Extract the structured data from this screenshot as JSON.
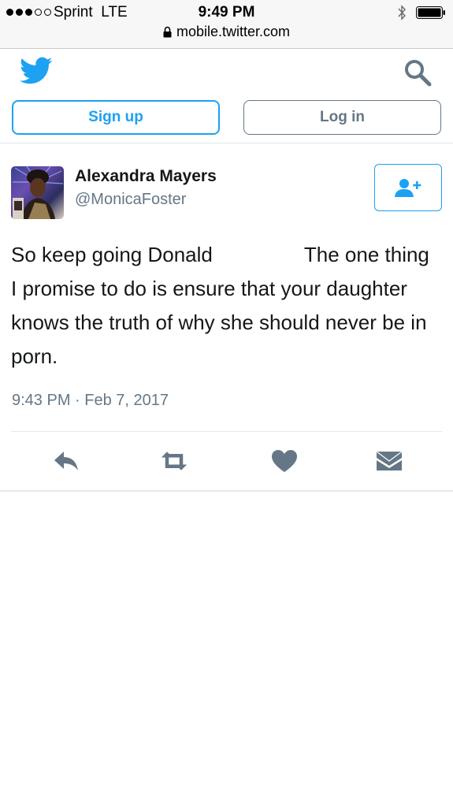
{
  "status_bar": {
    "carrier": "Sprint",
    "network": "LTE",
    "time": "9:49 PM",
    "signal_bars_filled": 3,
    "signal_bars_total": 5,
    "icons": [
      "signal-dots-icon",
      "bluetooth-icon",
      "battery-icon"
    ]
  },
  "browser": {
    "url": "mobile.twitter.com",
    "icons": [
      "lock-icon"
    ]
  },
  "header": {
    "icons": [
      "twitter-bird-icon",
      "search-icon"
    ],
    "signup_label": "Sign up",
    "login_label": "Log in"
  },
  "tweet": {
    "author_name": "Alexandra Mayers",
    "author_handle": "@MonicaFoster",
    "text_part1": "So keep going Donald",
    "text_part2": "The one thing I promise to do is ensure that your daughter knows the truth of why she should never be in porn.",
    "timestamp": "9:43 PM · Feb 7, 2017",
    "icons": [
      "avatar-image",
      "follow-user-icon"
    ]
  },
  "actions": {
    "icons": [
      "reply-icon",
      "retweet-icon",
      "like-icon",
      "direct-message-icon"
    ]
  },
  "colors": {
    "brand_blue": "#1da1f2",
    "secondary_gray": "#657786",
    "text_dark": "#14171a",
    "divider": "#e1e8ed"
  }
}
